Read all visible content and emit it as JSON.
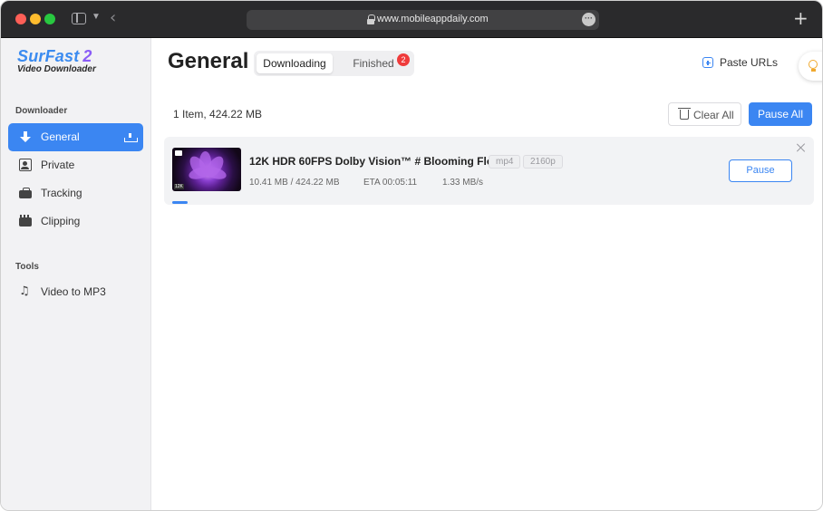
{
  "browser": {
    "url": "www.mobileappdaily.com"
  },
  "app": {
    "logo_main": "SurFast",
    "logo_version": "2",
    "logo_sub": "Video Downloader"
  },
  "sidebar": {
    "sections": [
      {
        "title": "Downloader"
      },
      {
        "title": "Tools"
      }
    ],
    "items": [
      {
        "label": "General",
        "icon": "download-icon",
        "active": true
      },
      {
        "label": "Private",
        "icon": "private-icon"
      },
      {
        "label": "Tracking",
        "icon": "tracking-icon"
      },
      {
        "label": "Clipping",
        "icon": "clipping-icon"
      },
      {
        "label": "Video to MP3",
        "icon": "music-note-icon"
      }
    ]
  },
  "header": {
    "title": "General",
    "tabs": [
      {
        "label": "Downloading",
        "active": true
      },
      {
        "label": "Finished",
        "badge": "2"
      }
    ],
    "paste_label": "Paste URLs"
  },
  "toolbar": {
    "summary": "1 Item, 424.22 MB",
    "clear_all_label": "Clear All",
    "pause_all_label": "Pause All"
  },
  "downloads": [
    {
      "title": "12K HDR 60FPS Dolby Vision™ # Blooming Flow...",
      "format": "mp4",
      "resolution": "2160p",
      "size_progress": "10.41 MB / 424.22 MB",
      "eta": "ETA 00:05:11",
      "speed": "1.33 MB/s",
      "progress_fraction": 0.0245,
      "action_label": "Pause"
    }
  ],
  "colors": {
    "accent": "#3b86f2",
    "badge": "#ef3b3b"
  }
}
